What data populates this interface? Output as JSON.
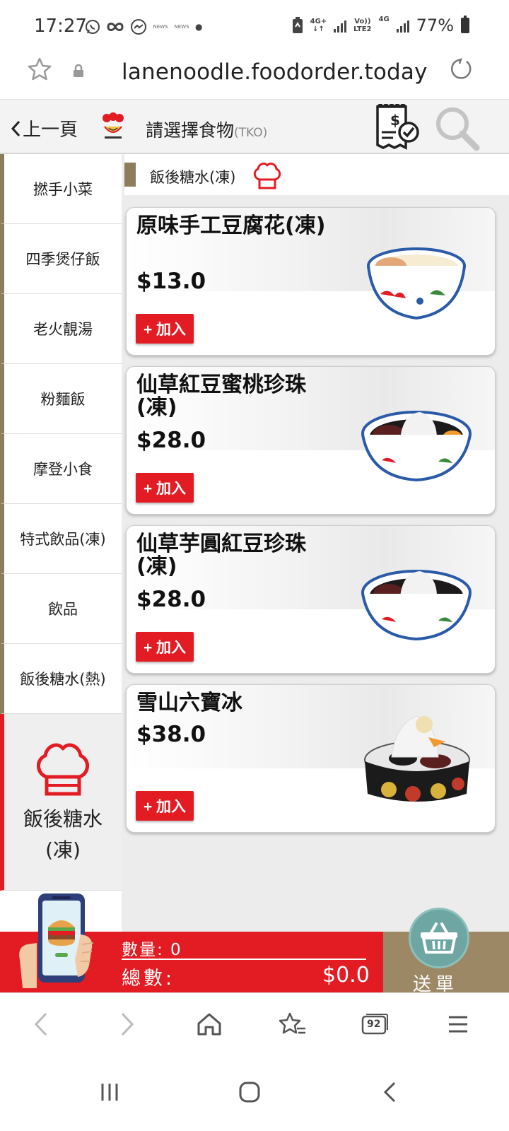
{
  "status_bar": {
    "time": "17:27",
    "net1_top": "4G+",
    "net1_bottom": "↓↑",
    "net2_top": "Vo))",
    "net2_bottom": "LTE2",
    "net3": "4G",
    "battery": "77%",
    "icons": [
      "whatsapp-icon",
      "infinity-icon",
      "messenger-icon",
      "news-icon",
      "news-icon",
      "dot-icon",
      "battery-saver-icon",
      "signal-icon",
      "signal-icon",
      "battery-icon"
    ],
    "news_label": "NEWS"
  },
  "browser": {
    "url": "lanenoodle.foodorder.today"
  },
  "header": {
    "back_label": "上一頁",
    "title": "請選擇食物",
    "store": "(TKO)"
  },
  "sidebar": {
    "items": [
      {
        "label": "撚手小菜"
      },
      {
        "label": "四季煲仔飯"
      },
      {
        "label": "老火靚湯"
      },
      {
        "label": "粉麵飯"
      },
      {
        "label": "摩登小食"
      },
      {
        "label": "特式飲品(凍)"
      },
      {
        "label": "飲品"
      },
      {
        "label": "飯後糖水(熱)"
      }
    ],
    "active": {
      "label_line1": "飯後糖水",
      "label_line2": "(凍)"
    }
  },
  "section": {
    "title": "飯後糖水(凍)"
  },
  "products": [
    {
      "name": "原味手工豆腐花(凍)",
      "price": "$13.0",
      "add_label": "+ 加入"
    },
    {
      "name": "仙草紅豆蜜桃珍珠(凍)",
      "price": "$28.0",
      "add_label": "+ 加入"
    },
    {
      "name": "仙草芋圓紅豆珍珠(凍)",
      "price": "$28.0",
      "add_label": "+ 加入"
    },
    {
      "name": "雪山六寶冰",
      "price": "$38.0",
      "add_label": "+ 加入"
    }
  ],
  "cart": {
    "qty_label": "數量: 0",
    "total_label": "總數:",
    "total_value": "$0.0",
    "submit_label": "送單"
  },
  "browser_nav": {
    "tabs_count": "92"
  },
  "colors": {
    "accent_red": "#e31b23",
    "brown": "#8c7d5c",
    "submit_brown": "#9c8865",
    "basket_teal": "#6ea6a3"
  }
}
